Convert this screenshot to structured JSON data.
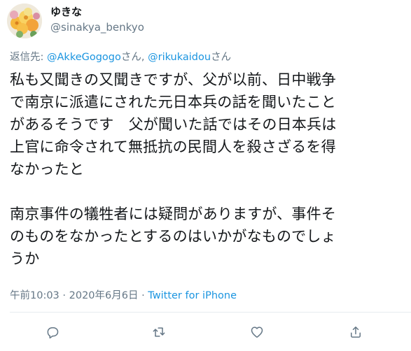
{
  "user": {
    "display_name": "ゆきな",
    "handle": "@sinakya_benkyo"
  },
  "reply": {
    "prefix": "返信先: ",
    "mention1": "@AkkeGogogo",
    "suffix1": "さん, ",
    "mention2": "@rikukaidou",
    "suffix2": "さん"
  },
  "tweet": {
    "text": "私も又聞きの又聞きですが、父が以前、日中戦争\nで南京に派遣にされた元日本兵の話を聞いたこと\nがあるそうです　父が聞いた話ではその日本兵は\n上官に命令されて無抵抗の民間人を殺さざるを得\nなかったと\n\n南京事件の犠牲者には疑問がありますが、事件そ\nのものをなかったとするのはいかがなものでしょ\nうか"
  },
  "meta": {
    "timestamp": "午前10:03 · 2020年6月6日 · ",
    "source": "Twitter for iPhone"
  },
  "actions": {
    "reply_icon": "reply-icon",
    "retweet_icon": "retweet-icon",
    "like_icon": "like-icon",
    "share_icon": "share-icon"
  },
  "colors": {
    "link": "#1b95e0",
    "secondary_text": "#657786",
    "primary_text": "#14171a"
  }
}
